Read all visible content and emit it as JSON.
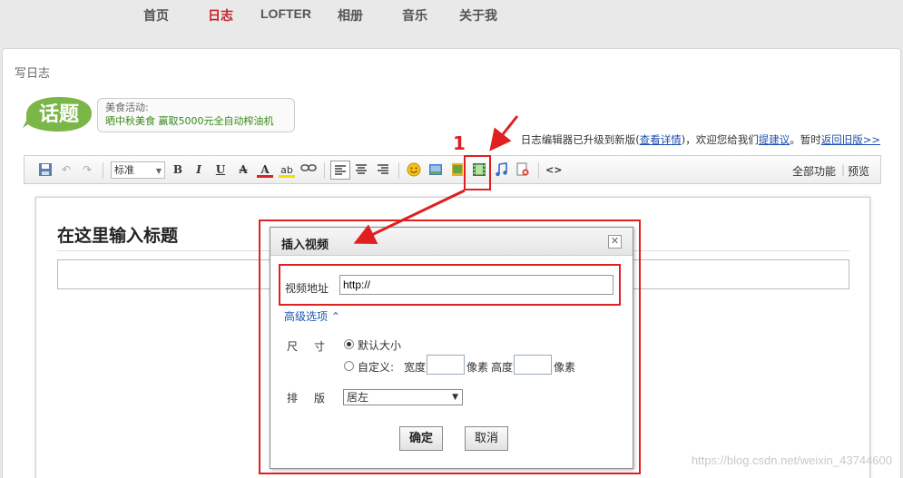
{
  "nav": {
    "items": [
      "首页",
      "日志",
      "LOFTER",
      "相册",
      "音乐",
      "关于我"
    ]
  },
  "page_title": "写日志",
  "topic": {
    "logo_text": "话题",
    "label": "美食活动:",
    "link": "晒中秋美食 赢取5000元全自动榨油机"
  },
  "notice": {
    "prefix": "日志编辑器已升级到新版(",
    "link1": "查看详情",
    "mid": ")，欢迎您给我们",
    "link2": "提建议",
    "mid2": "。暂时",
    "link3": "返回旧版>>"
  },
  "toolbar": {
    "style_select": "标准",
    "bold": "B",
    "italic": "I",
    "underline": "U",
    "strike": "A",
    "font_color": "A",
    "highlight": "ab",
    "code": "<>",
    "all_features": "全部功能",
    "separator": "|",
    "preview": "预览"
  },
  "editor": {
    "title_placeholder": "在这里输入标题"
  },
  "dialog": {
    "title": "插入视频",
    "close": "✕",
    "url_label": "视频地址",
    "url_value": "http://",
    "advanced": "高级选项",
    "advanced_icon": "⌃",
    "size_label": "尺寸",
    "default_size": "默认大小",
    "custom_label": "自定义:",
    "width_label": "宽度",
    "pixel_unit": "像素",
    "height_label": "高度",
    "layout_label": "排版",
    "layout_value": "居左",
    "confirm": "确定",
    "cancel": "取消"
  },
  "annotation": {
    "step_number": "1",
    "color": "#e02020"
  },
  "watermark": "https://blog.csdn.net/weixin_43744600"
}
